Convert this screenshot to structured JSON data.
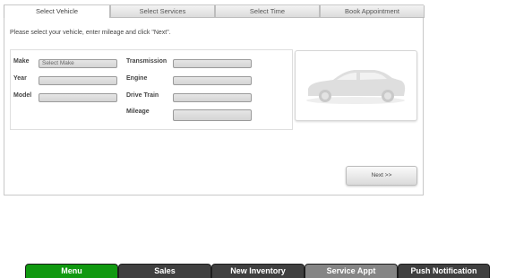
{
  "tabs": [
    {
      "label": "Select Vehicle",
      "active": true
    },
    {
      "label": "Select Services",
      "active": false
    },
    {
      "label": "Select Time",
      "active": false
    },
    {
      "label": "Book Appointment",
      "active": false
    }
  ],
  "instructions": "Please select your vehicle, enter mileage and click \"Next\".",
  "form": {
    "make_label": "Make",
    "make_value": "Select Make",
    "year_label": "Year",
    "model_label": "Model",
    "transmission_label": "Transmission",
    "engine_label": "Engine",
    "drive_train_label": "Drive Train",
    "mileage_label": "Mileage"
  },
  "next_button": "Next >>",
  "bottom_nav": [
    {
      "label": "Menu",
      "color": "#109910"
    },
    {
      "label": "Sales",
      "color": "#404040"
    },
    {
      "label": "New Inventory",
      "color": "#404040"
    },
    {
      "label": "Service Appt",
      "color": "#858585"
    },
    {
      "label": "Push Notification",
      "color": "#404040"
    }
  ],
  "icons": {
    "vehicle_image": "car-silhouette-icon"
  }
}
